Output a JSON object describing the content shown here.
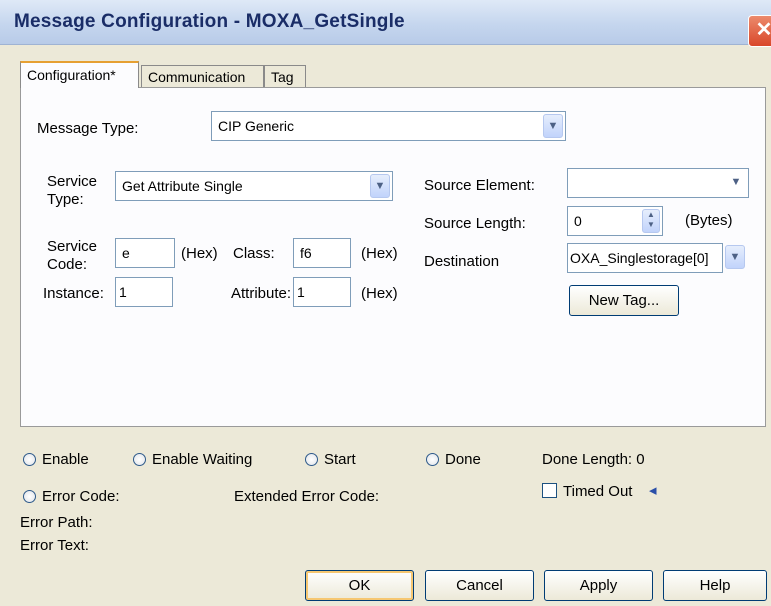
{
  "window": {
    "title": "Message Configuration - MOXA_GetSingle",
    "close_glyph": "✕"
  },
  "tabs": [
    "Configuration*",
    "Communication",
    "Tag"
  ],
  "config": {
    "message_type_label": "Message Type:",
    "message_type_value": "CIP Generic",
    "service_type_label_1": "Service",
    "service_type_label_2": "Type:",
    "service_type_value": "Get Attribute Single",
    "service_code_label_1": "Service",
    "service_code_label_2": "Code:",
    "service_code_value": "e",
    "hex_label": "(Hex)",
    "class_label": "Class:",
    "class_value": "f6",
    "instance_label": "Instance:",
    "instance_value": "1",
    "attribute_label": "Attribute:",
    "attribute_value": "1",
    "source_element_label": "Source Element:",
    "source_element_value": "",
    "source_length_label": "Source Length:",
    "source_length_value": "0",
    "bytes_label": "(Bytes)",
    "destination_label": "Destination",
    "destination_value": "OXA_Singlestorage[0]",
    "new_tag_label": "New Tag..."
  },
  "status": {
    "enable": "Enable",
    "enable_waiting": "Enable Waiting",
    "start": "Start",
    "done": "Done",
    "done_length": "Done Length: 0",
    "error_code": "Error Code:",
    "extended_error_code": "Extended Error Code:",
    "timed_out": "Timed Out",
    "error_path": "Error Path:",
    "error_text": "Error Text:"
  },
  "buttons": {
    "ok": "OK",
    "cancel": "Cancel",
    "apply": "Apply",
    "help": "Help"
  },
  "icons": {
    "dropdown": "chevron-down-icon",
    "spinner": "spinner-icon",
    "timed_out_arrow": "arrow-left-icon"
  },
  "colors": {
    "accent": "#e6a032",
    "title_text": "#1a2d67",
    "close_button": "#d9472a"
  }
}
